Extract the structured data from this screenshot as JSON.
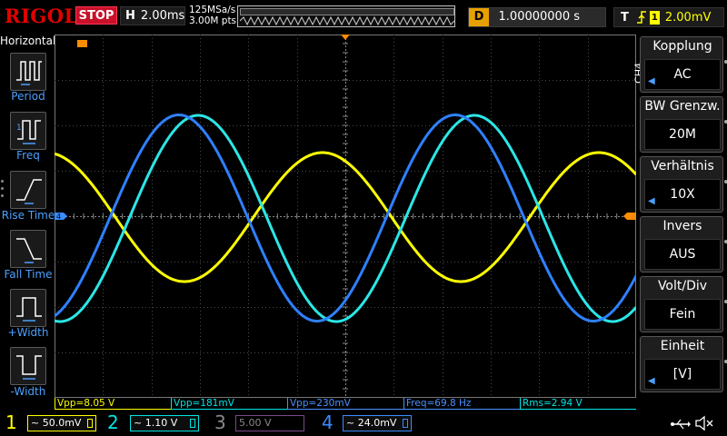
{
  "topbar": {
    "logo": "RIGOL",
    "run_state": "STOP",
    "timebase_letter": "H",
    "timebase_value": "2.00ms",
    "sample_rate": "125MSa/s",
    "memory_depth": "3.00M pts",
    "delay_letter": "D",
    "delay_value": "1.00000000 s",
    "trigger_letter": "T",
    "trigger_source": "1",
    "trigger_level": "2.00mV"
  },
  "left_menu": {
    "title": "Horizontal",
    "items": [
      {
        "label": "Period",
        "icon": "period-icon"
      },
      {
        "label": "Freq",
        "icon": "freq-icon"
      },
      {
        "label": "Rise Time",
        "icon": "rise-time-icon"
      },
      {
        "label": "Fall Time",
        "icon": "fall-time-icon"
      },
      {
        "label": "+Width",
        "icon": "positive-width-icon"
      },
      {
        "label": "-Width",
        "icon": "negative-width-icon"
      }
    ]
  },
  "right_menu": {
    "channel": "CH4",
    "items": [
      {
        "title": "Kopplung",
        "value": "AC",
        "has_arrow": true
      },
      {
        "title": "BW Grenzw.",
        "value": "20M",
        "has_arrow": false
      },
      {
        "title": "Verhältnis",
        "value": "10X",
        "has_arrow": true
      },
      {
        "title": "Invers",
        "value": "AUS",
        "has_arrow": false
      },
      {
        "title": "Volt/Div",
        "value": "Fein",
        "has_arrow": false
      },
      {
        "title": "Einheit",
        "value": "[V]",
        "has_arrow": true
      }
    ]
  },
  "measurements": [
    {
      "text": "Vpp=8.05 V",
      "color": "#ffff00"
    },
    {
      "text": "Vpp=181mV",
      "color": "#00e5e5"
    },
    {
      "text": "Vpp=230mV",
      "color": "#4a90ff"
    },
    {
      "text": "Freq=69.8 Hz",
      "color": "#4a90ff"
    },
    {
      "text": "Rms=2.94 V",
      "color": "#00e5e5"
    }
  ],
  "channels": [
    {
      "number": "1",
      "scale": "~ 50.0mV",
      "color": "#ffff00",
      "enabled": true
    },
    {
      "number": "2",
      "scale": "~ 1.10 V",
      "color": "#00e5e5",
      "enabled": true
    },
    {
      "number": "3",
      "scale": "5.00 V",
      "color": "#d23cff",
      "enabled": false
    },
    {
      "number": "4",
      "scale": "~ 24.0mV",
      "color": "#3a8cff",
      "enabled": true
    }
  ],
  "markers": {
    "trigger_position": "T",
    "channel4_ground": "4"
  },
  "colors": {
    "ch1": "#ffff00",
    "ch2": "#2ce6e6",
    "ch4": "#2f80ff",
    "grid": "#4a4a4a",
    "trigger_marker": "#ff8c00",
    "menu_accent": "#4aa0ff"
  },
  "chart_data": {
    "type": "line",
    "x_divisions": 12,
    "y_divisions": 8,
    "xlim": [
      0,
      12
    ],
    "ylim": [
      -4,
      4
    ],
    "grid": true,
    "series": [
      {
        "name": "1",
        "color": "#ffff00",
        "amplitude": 1.42,
        "offset": -0.02,
        "period": 5.7,
        "phase": 0.28
      },
      {
        "name": "2",
        "color": "#2ce6e6",
        "amplitude": 2.27,
        "offset": -0.05,
        "period": 5.7,
        "phase": -0.27
      },
      {
        "name": "4",
        "color": "#2f80ff",
        "amplitude": 2.27,
        "offset": -0.04,
        "period": 5.7,
        "phase": -0.2
      }
    ]
  }
}
